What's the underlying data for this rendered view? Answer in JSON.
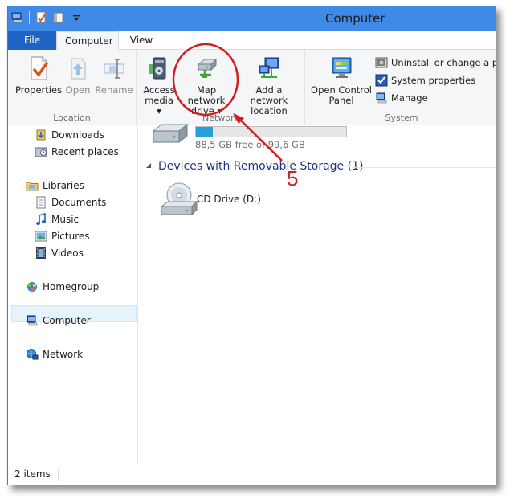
{
  "window": {
    "title": "Computer"
  },
  "tabs": {
    "file": "File",
    "computer": "Computer",
    "view": "View"
  },
  "ribbon": {
    "location": {
      "label": "Location",
      "properties": "Properties",
      "open": "Open",
      "rename": "Rename"
    },
    "network": {
      "label": "Network",
      "access_media_1": "Access",
      "access_media_2": "media",
      "map_drive_1": "Map network",
      "map_drive_2": "drive",
      "add_location_1": "Add a network",
      "add_location_2": "location"
    },
    "system": {
      "label": "System",
      "control_panel_1": "Open Control",
      "control_panel_2": "Panel",
      "uninstall": "Uninstall or change a prog",
      "system_properties": "System properties",
      "manage": "Manage"
    },
    "dropdown_glyph": "▾"
  },
  "nav": {
    "downloads": "Downloads",
    "recent_places": "Recent places",
    "libraries": "Libraries",
    "documents": "Documents",
    "music": "Music",
    "pictures": "Pictures",
    "videos": "Videos",
    "homegroup": "Homegroup",
    "computer": "Computer",
    "network": "Network"
  },
  "content": {
    "drive_free": "88,5 GB free of 99,6 GB",
    "drive_used_fraction": 0.11,
    "section_title": "Devices with Removable Storage (1)",
    "cd_drive": "CD Drive (D:)"
  },
  "status": {
    "items": "2 items"
  },
  "annotation": {
    "step": "5",
    "color": "#d21e1e"
  }
}
